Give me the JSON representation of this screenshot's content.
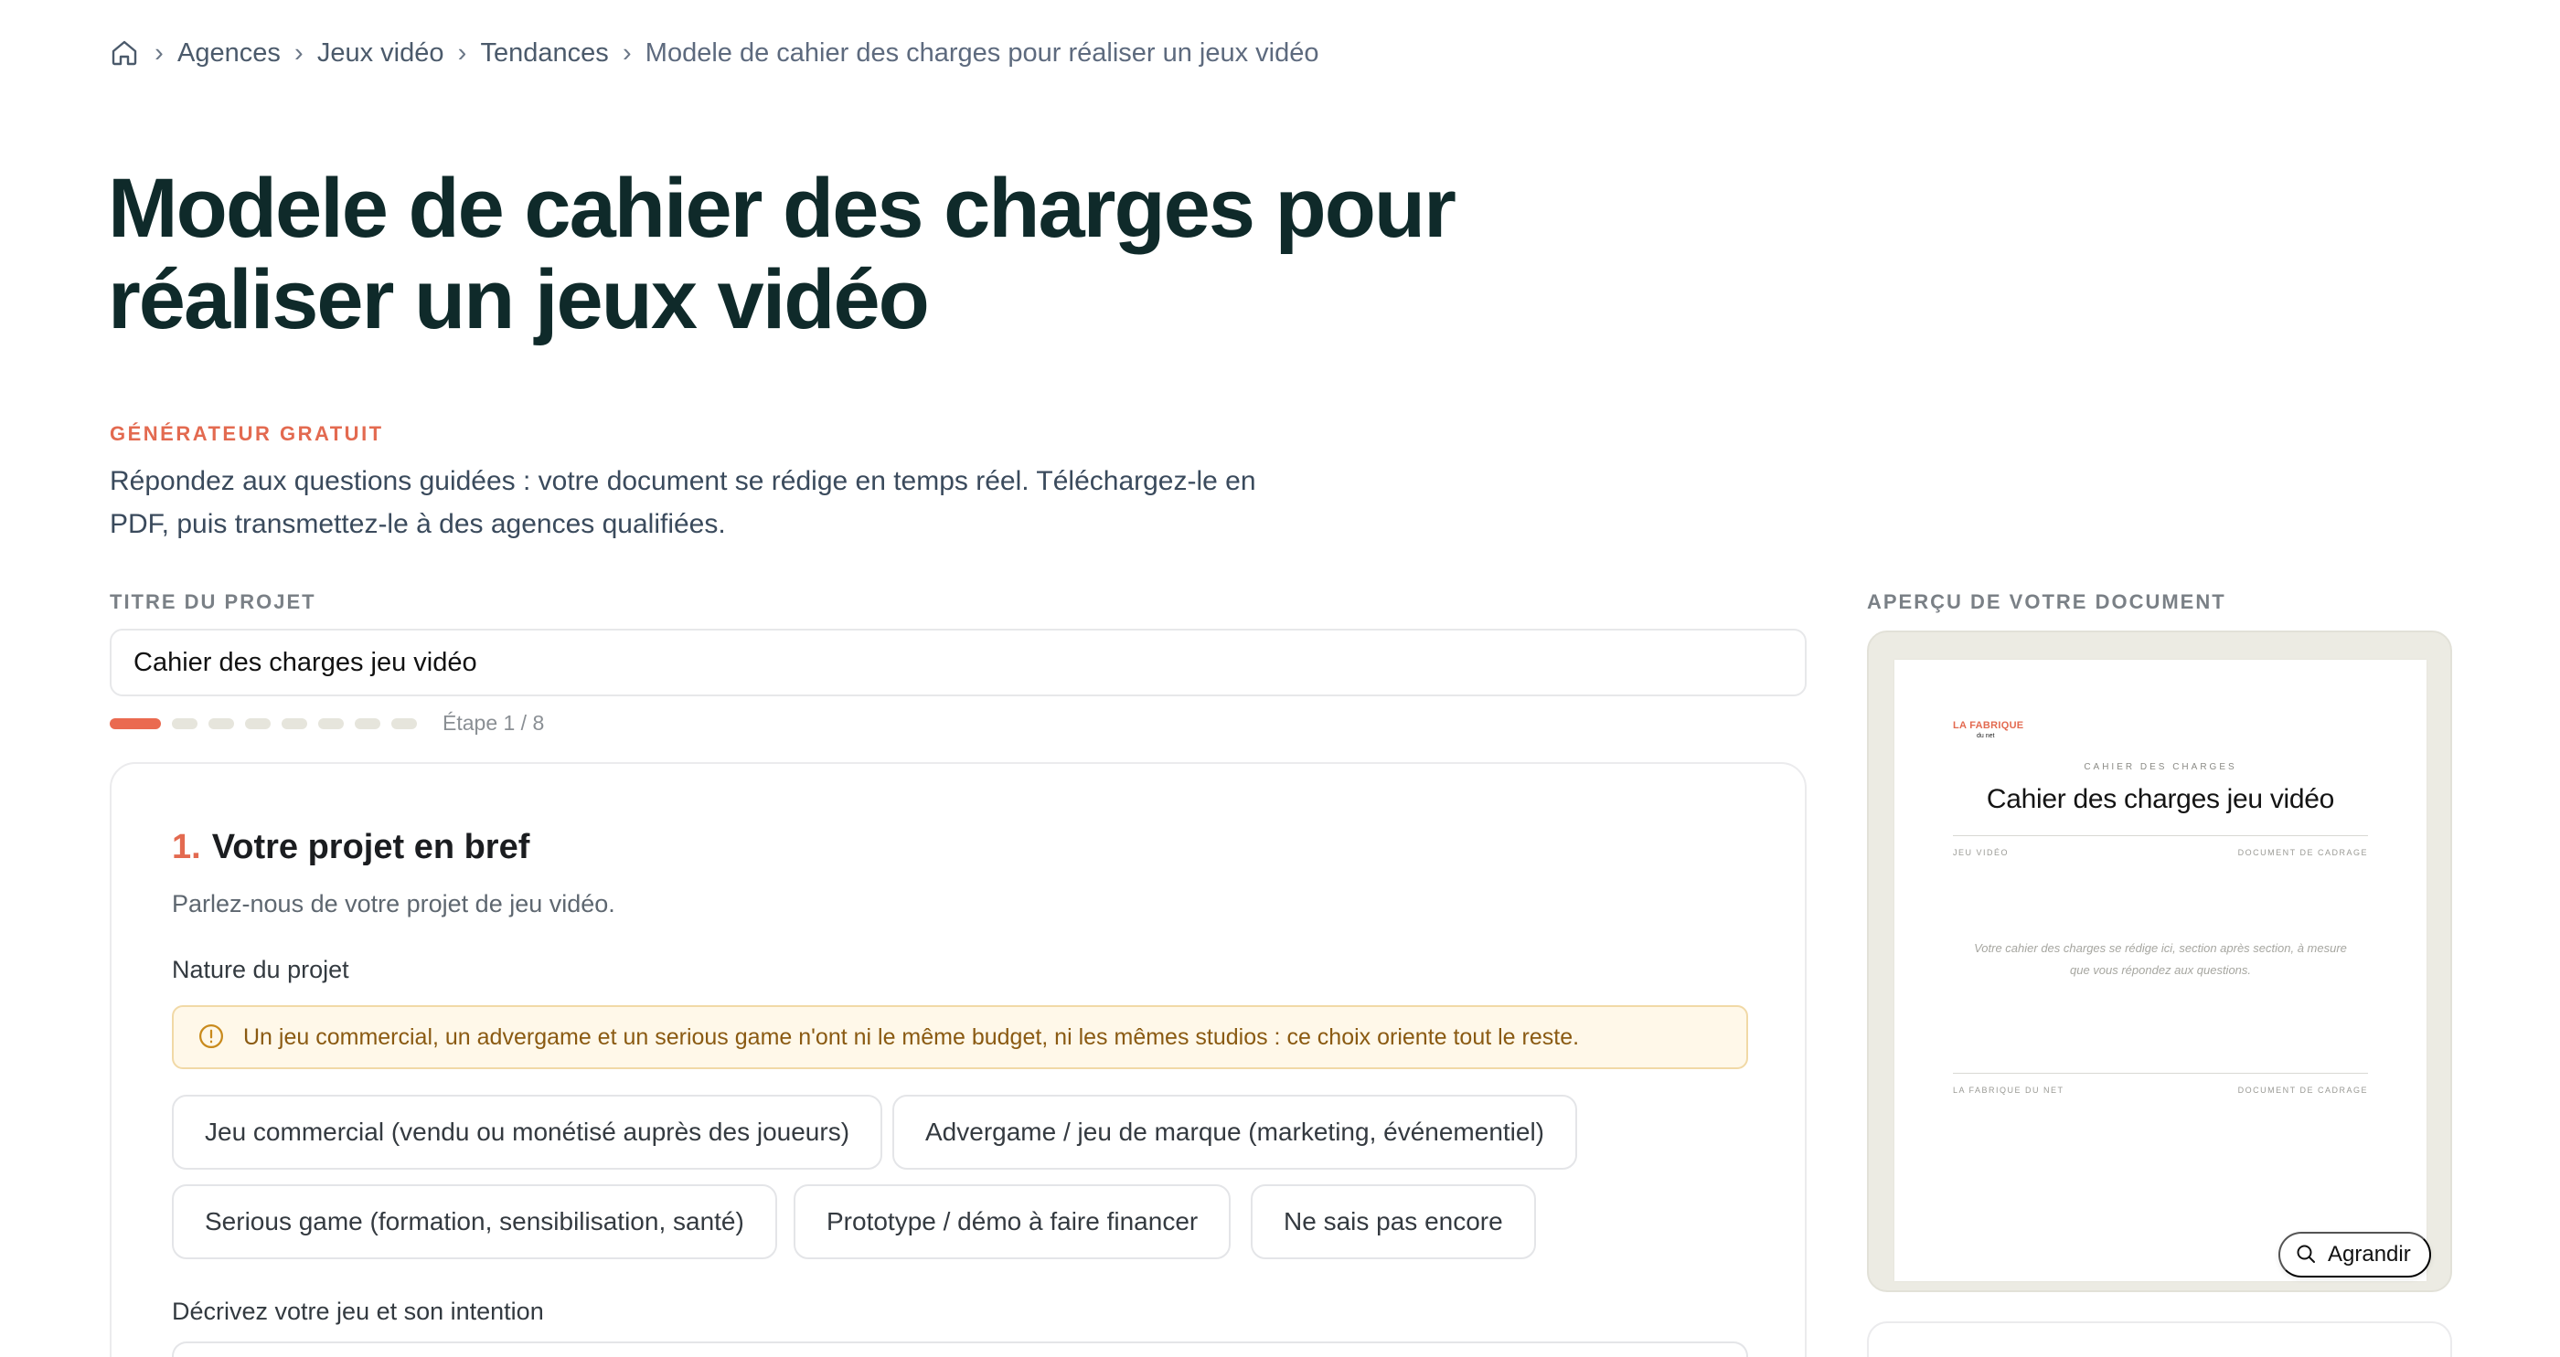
{
  "breadcrumb": {
    "items": [
      "Agences",
      "Jeux vidéo",
      "Tendances"
    ],
    "current": "Modele de cahier des charges pour réaliser un jeux vidéo"
  },
  "page": {
    "title_line1": "Modele de cahier des charges pour",
    "title_line2": "réaliser un jeux vidéo",
    "eyebrow": "GÉNÉRATEUR GRATUIT",
    "intro_line1": "Répondez aux questions guidées : votre document se rédige en temps réel. Téléchargez-le en",
    "intro_line2": "PDF, puis transmettez-le à des agences qualifiées."
  },
  "project": {
    "label": "TITRE DU PROJET",
    "value": "Cahier des charges jeu vidéo"
  },
  "progress": {
    "label": "Étape 1 / 8",
    "current": 1,
    "total": 8
  },
  "section": {
    "number": "1.",
    "title": "Votre projet en bref",
    "subtitle": "Parlez-nous de votre projet de jeu vidéo.",
    "q1_label": "Nature du projet",
    "info": "Un jeu commercial, un advergame et un serious game n'ont ni le même budget, ni les mêmes studios : ce choix oriente tout le reste.",
    "options": [
      "Jeu commercial (vendu ou monétisé auprès des joueurs)",
      "Advergame / jeu de marque (marketing, événementiel)",
      "Serious game (formation, sensibilisation, santé)",
      "Prototype / démo à faire financer",
      "Ne sais pas encore"
    ],
    "q2_label": "Décrivez votre jeu et son intention"
  },
  "preview": {
    "label": "APERÇU DE VOTRE DOCUMENT",
    "logo": "LA FABRIQUE",
    "logo_sub": "du net",
    "kicker": "CAHIER DES CHARGES",
    "title": "Cahier des charges jeu vidéo",
    "meta_left": "JEU VIDÉO",
    "meta_right": "DOCUMENT DE CADRAGE",
    "placeholder_line1": "Votre cahier des charges se rédige ici, section après section, à mesure",
    "placeholder_line2": "que vous répondez aux questions.",
    "footer_left": "LA FABRIQUE DU NET",
    "footer_right": "DOCUMENT DE CADRAGE",
    "zoom_label": "Agrandir"
  },
  "colors": {
    "accent": "#e36a50",
    "title": "#0f2a2a",
    "info_bg": "#fff8e9",
    "info_text": "#8a5a12"
  }
}
